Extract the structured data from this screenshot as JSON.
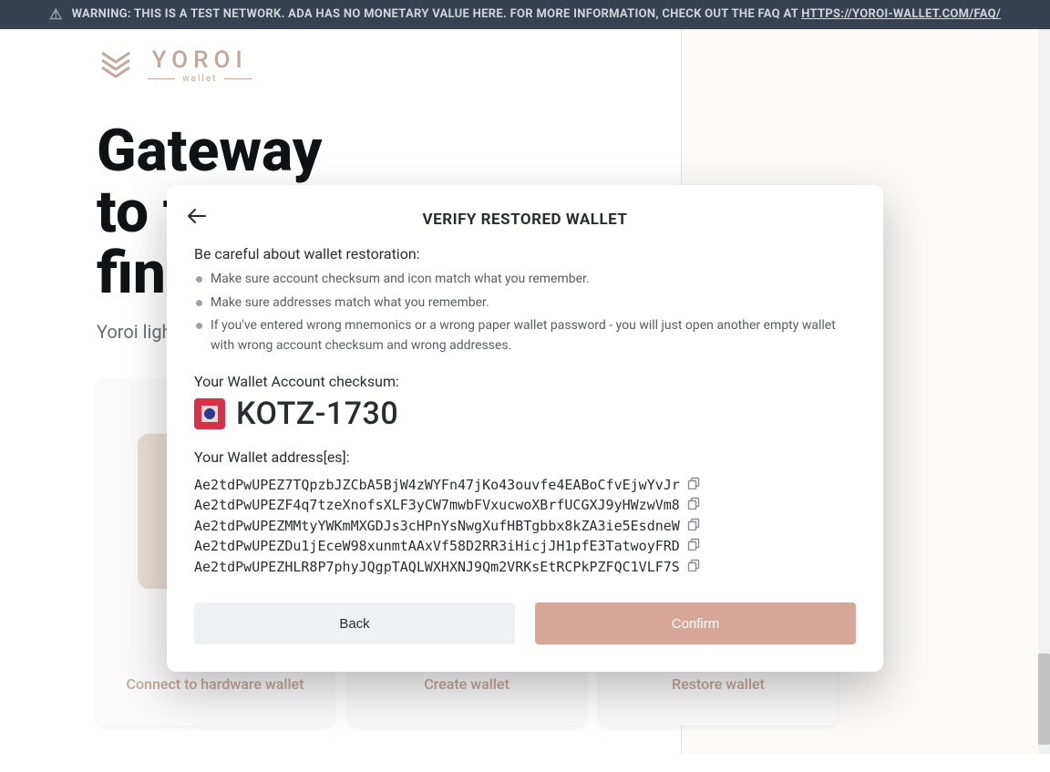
{
  "warning": {
    "prefix": "WARNING: THIS IS A TEST NETWORK. ADA HAS NO MONETARY VALUE HERE. FOR MORE INFORMATION, CHECK OUT THE FAQ AT ",
    "link_text": "HTTPS://YOROI-WALLET.COM/FAQ/"
  },
  "logo": {
    "brand": "YOROI",
    "sub": "wallet"
  },
  "hero": {
    "title_line1": "Gateway",
    "title_line2": "to the",
    "title_line3": "financial world",
    "subtitle": "Yoroi light wallet for Cardano"
  },
  "cards": [
    {
      "label": "Connect to hardware wallet"
    },
    {
      "label": "Create wallet"
    },
    {
      "label": "Restore wallet"
    }
  ],
  "modal": {
    "title": "VERIFY RESTORED WALLET",
    "intro": "Be careful about wallet restoration:",
    "bullets": [
      "Make sure account checksum and icon match what you remember.",
      "Make sure addresses match what you remember.",
      "If you've entered wrong mnemonics or a wrong paper wallet password - you will just open another empty wallet with wrong account checksum and wrong addresses."
    ],
    "checksum_label": "Your Wallet Account checksum:",
    "checksum_value": "KOTZ-1730",
    "addresses_label": "Your Wallet address[es]:",
    "addresses": [
      "Ae2tdPwUPEZ7TQpzbJZCbA5BjW4zWYFn47jKo43ouvfe4EABoCfvEjwYvJr",
      "Ae2tdPwUPEZF4q7tzeXnofsXLF3yCW7mwbFVxucwoXBrfUCGXJ9yHWzwVm8",
      "Ae2tdPwUPEZMMtyYWKmMXGDJs3cHPnYsNwgXufHBTgbbx8kZA3ie5EsdneW",
      "Ae2tdPwUPEZDu1jEceW98xunmtAAxVf58D2RR3iHicjJH1pfE3TatwoyFRD",
      "Ae2tdPwUPEZHLR8P7phyJQgpTAQLWXHXNJ9Qm2VRKsEtRCPkPZFQC1VLF7S"
    ],
    "back_label": "Back",
    "confirm_label": "Confirm"
  }
}
